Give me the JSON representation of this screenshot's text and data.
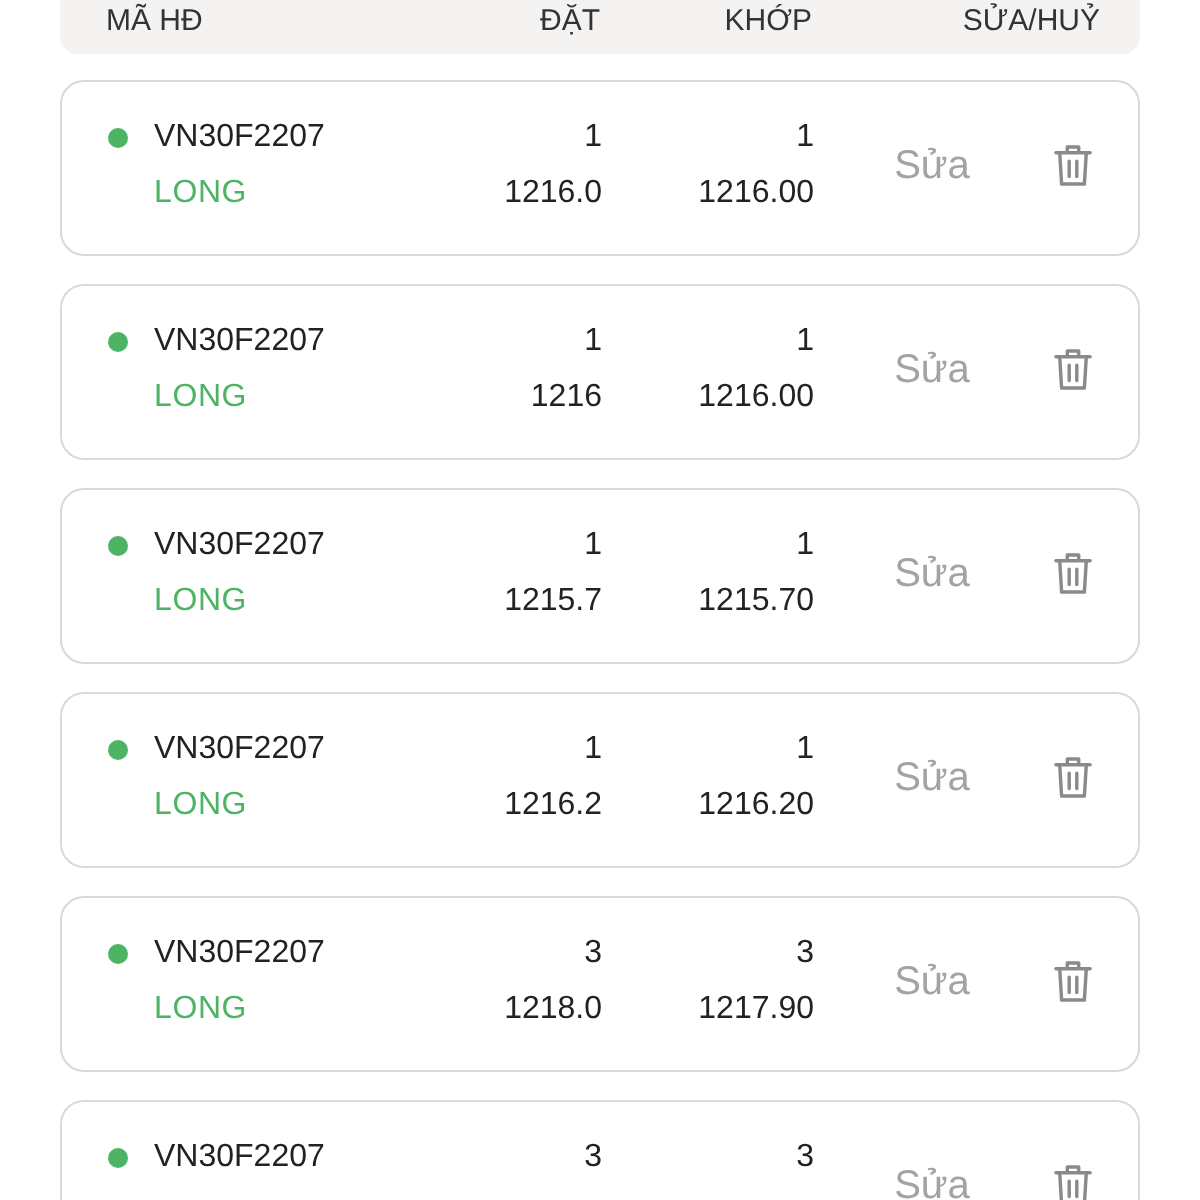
{
  "table": {
    "columns": [
      "MÃ HĐ",
      "ĐẶT",
      "KHỚP",
      "SỬA/HUỶ"
    ]
  },
  "orders": [
    {
      "contract": "VN30F2207",
      "color": "#4cb464",
      "side": "LONG",
      "order_qty": "1",
      "order_price": "1216.0",
      "matched_qty": "1",
      "matched_price": "1216.00",
      "edit_label": "Sửa"
    },
    {
      "contract": "VN30F2207",
      "color": "#4cb464",
      "side": "LONG",
      "order_qty": "1",
      "order_price": "1216",
      "matched_qty": "1",
      "matched_price": "1216.00",
      "edit_label": "Sửa"
    },
    {
      "contract": "VN30F2207",
      "color": "#4cb464",
      "side": "LONG",
      "order_qty": "1",
      "order_price": "1215.7",
      "matched_qty": "1",
      "matched_price": "1215.70",
      "edit_label": "Sửa"
    },
    {
      "contract": "VN30F2207",
      "color": "#4cb464",
      "side": "LONG",
      "order_qty": "1",
      "order_price": "1216.2",
      "matched_qty": "1",
      "matched_price": "1216.20",
      "edit_label": "Sửa"
    },
    {
      "contract": "VN30F2207",
      "color": "#4cb464",
      "side": "LONG",
      "order_qty": "3",
      "order_price": "1218.0",
      "matched_qty": "3",
      "matched_price": "1217.90",
      "edit_label": "Sửa"
    },
    {
      "contract": "VN30F2207",
      "color": "#4cb464",
      "order_qty": "3",
      "matched_qty": "3",
      "edit_label": "Sửa"
    }
  ]
}
